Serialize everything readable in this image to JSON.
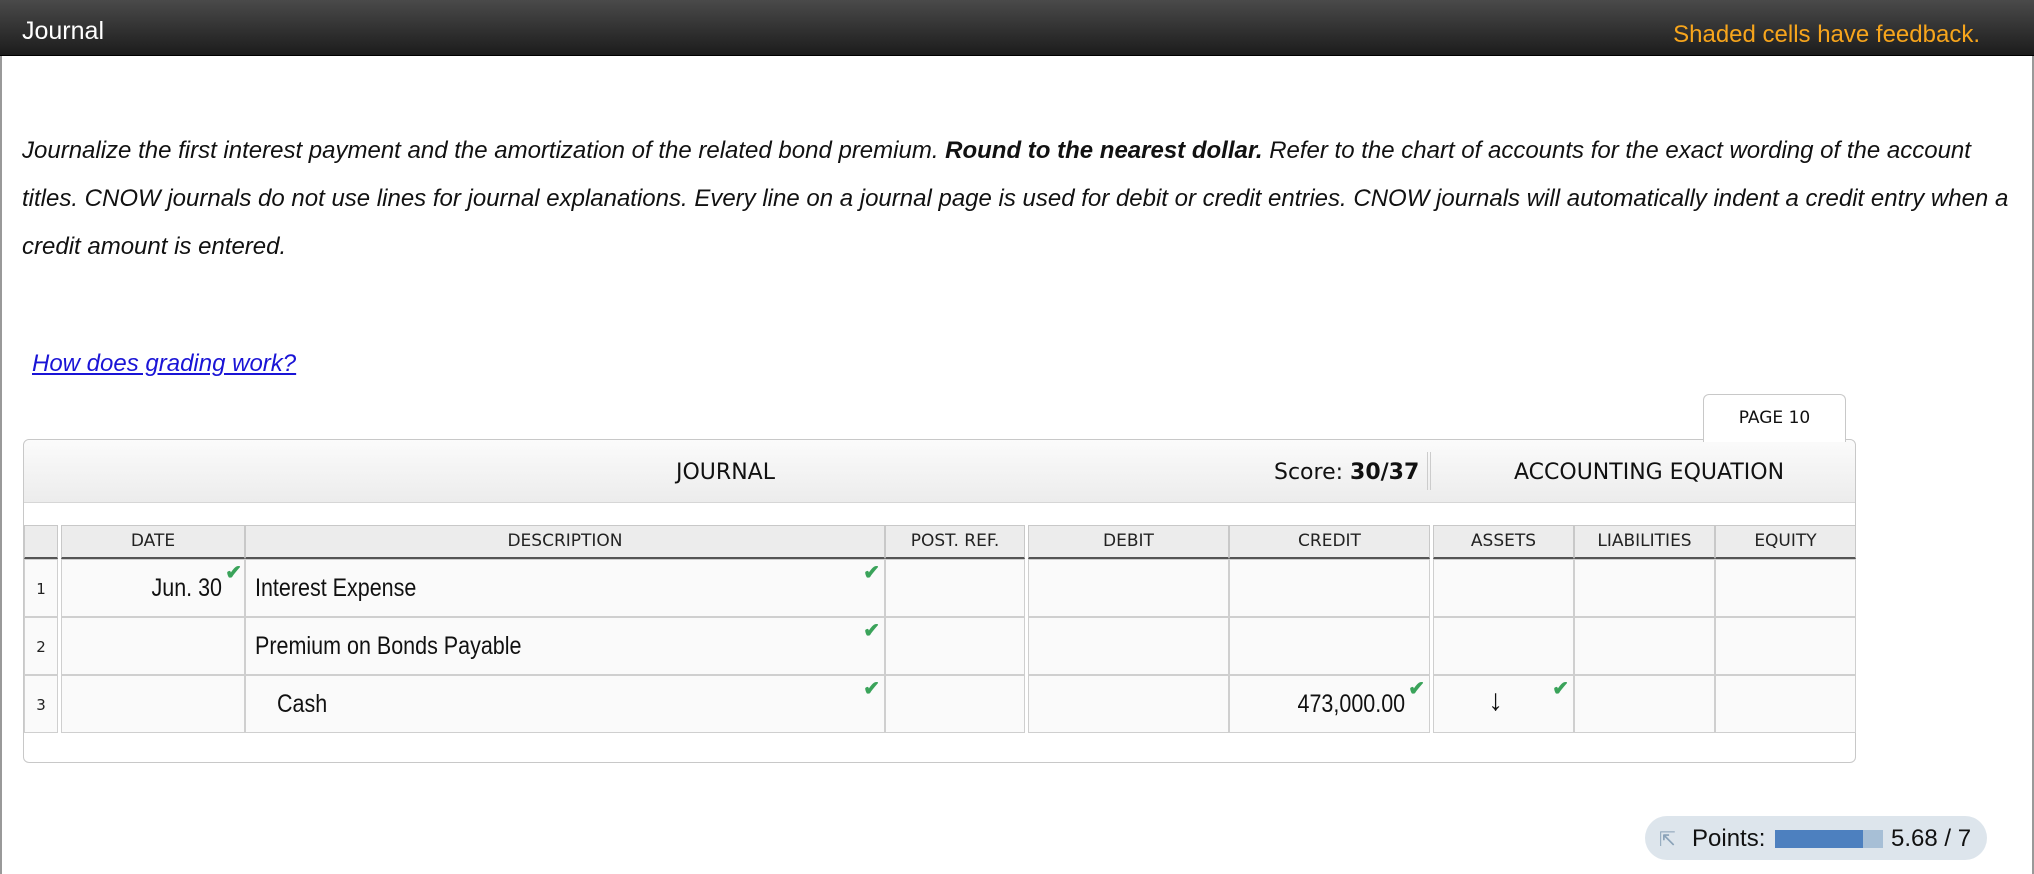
{
  "header": {
    "title": "Journal",
    "feedback_note": "Shaded cells have feedback."
  },
  "instructions": {
    "part1": "Journalize the first interest payment and the amortization of the related bond premium. ",
    "bold": "Round to the nearest dollar.",
    "part2": " Refer to the chart of accounts for the exact wording of the account titles. CNOW journals do not use lines for journal explanations. Every line on a journal page is used for debit or credit entries. CNOW journals will automatically indent a credit entry when a credit amount is entered."
  },
  "help_link": "How does grading work?",
  "page_tab": "PAGE 10",
  "journal": {
    "title": "JOURNAL",
    "score_label": "Score:",
    "score_value": "30/37",
    "accounting_equation_title": "ACCOUNTING EQUATION",
    "columns": [
      "DATE",
      "DESCRIPTION",
      "POST. REF.",
      "DEBIT",
      "CREDIT",
      "ASSETS",
      "LIABILITIES",
      "EQUITY"
    ],
    "rows": [
      {
        "num": "1",
        "date": "Jun. 30",
        "description": "Interest Expense",
        "post_ref": "",
        "debit": "",
        "credit": "",
        "assets": "",
        "liabilities": "",
        "equity": ""
      },
      {
        "num": "2",
        "date": "",
        "description": "Premium on Bonds Payable",
        "post_ref": "",
        "debit": "",
        "credit": "",
        "assets": "",
        "liabilities": "",
        "equity": ""
      },
      {
        "num": "3",
        "date": "",
        "description": "Cash",
        "post_ref": "",
        "debit": "",
        "credit": "473,000.00",
        "assets": "↓",
        "liabilities": "",
        "equity": ""
      }
    ],
    "correct_mark": "✔",
    "correct_color": "#3aa35a"
  },
  "points": {
    "label": "Points:",
    "value": "5.68 / 7",
    "fraction": 0.811,
    "bar_color": "#4d80bf"
  }
}
